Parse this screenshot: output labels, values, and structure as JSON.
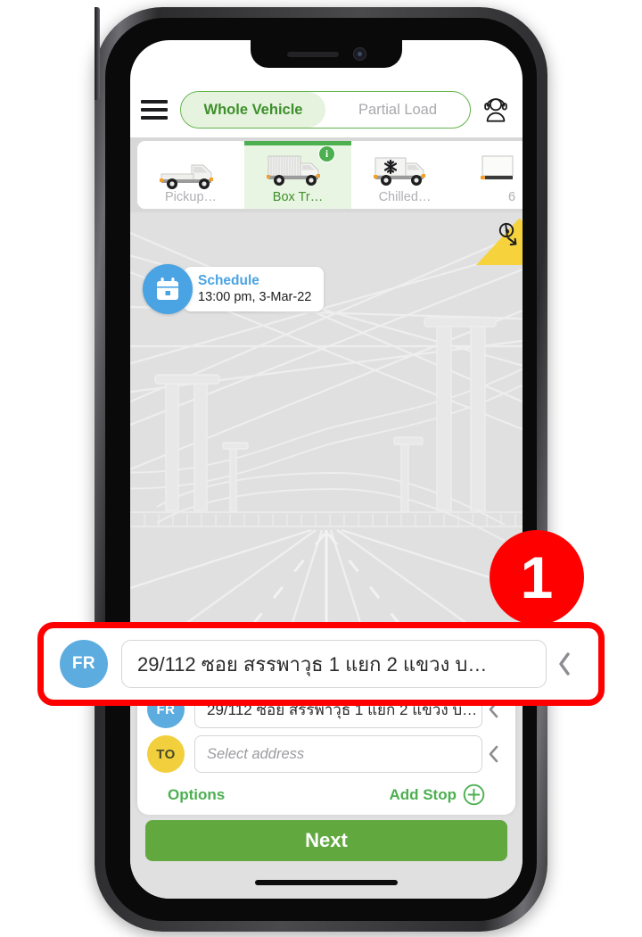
{
  "app": {
    "header": {
      "menu_icon": "hamburger-menu-icon",
      "support_icon": "customer-support-headset-icon",
      "modes": [
        {
          "label": "Whole Vehicle",
          "active": true
        },
        {
          "label": "Partial Load",
          "active": false
        }
      ]
    },
    "vehicle_types": [
      {
        "label": "Pickup…",
        "icon": "pickup-truck-icon",
        "selected": false,
        "info_badge": null
      },
      {
        "label": "Box Tr…",
        "icon": "box-truck-icon",
        "selected": true,
        "info_badge": "i"
      },
      {
        "label": "Chilled…",
        "icon": "chilled-truck-icon",
        "selected": false,
        "info_badge": null
      },
      {
        "label": "6",
        "icon": "truck-icon",
        "selected": false,
        "info_badge": null
      }
    ],
    "map": {
      "schedule": {
        "icon": "calendar-icon",
        "title": "Schedule",
        "time": "13:00 pm, 3-Mar-22"
      },
      "restriction_badge": {
        "icon": "truck-restriction-icon",
        "color": "#f6d33c"
      }
    },
    "bottom_sheet": {
      "from": {
        "avatar": "FR",
        "value": "29/112 ซอย สรรพาวุธ 1 แยก 2 แขวง บ…",
        "chevron": "chevron-left-icon"
      },
      "to": {
        "avatar": "TO",
        "placeholder": "Select address",
        "value": "",
        "chevron": "chevron-left-icon"
      },
      "options_label": "Options",
      "add_stop_label": "Add Stop",
      "add_stop_icon": "plus-circle-icon"
    },
    "next_button": "Next"
  },
  "annotation": {
    "step_number": "1",
    "highlight_color": "#ff0000",
    "from": {
      "avatar": "FR",
      "value": "29/112 ซอย สรรพาวุธ 1 แยก 2 แขวง บ…",
      "chevron": "chevron-left-icon"
    }
  },
  "colors": {
    "brand_green": "#4caf50",
    "next_green": "#61a93f",
    "from_blue": "#5cacdf",
    "to_yellow": "#f2cf3c",
    "schedule_blue": "#4aa3e3",
    "annotation_red": "#ff0000"
  }
}
